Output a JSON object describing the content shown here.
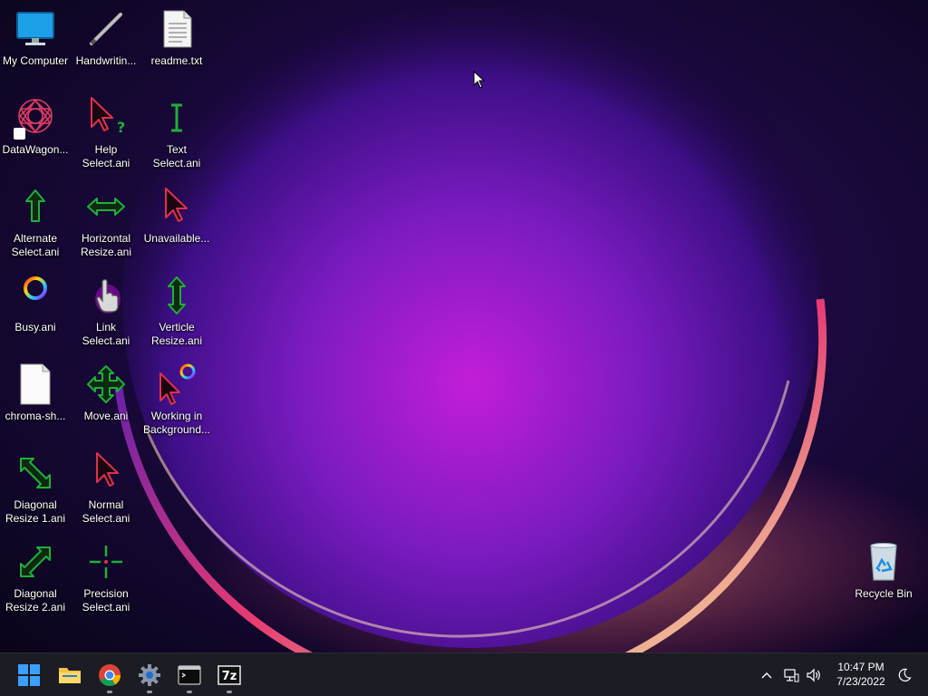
{
  "desktop": {
    "icons": [
      {
        "label": "My Computer",
        "icon": "monitor-icon"
      },
      {
        "label": "Handwritin...",
        "icon": "pen-icon"
      },
      {
        "label": "readme.txt",
        "icon": "text-file-icon"
      },
      {
        "label": "DataWagon...",
        "icon": "mandala-shortcut-icon"
      },
      {
        "label": "Help\nSelect.ani",
        "icon": "help-cursor-icon"
      },
      {
        "label": "Text Select.ani",
        "icon": "text-cursor-icon"
      },
      {
        "label": "Alternate\nSelect.ani",
        "icon": "up-arrow-cursor-icon"
      },
      {
        "label": "Horizontal\nResize.ani",
        "icon": "horizontal-resize-icon"
      },
      {
        "label": "Unavailable...",
        "icon": "unavailable-cursor-icon"
      },
      {
        "label": "Busy.ani",
        "icon": "busy-ring-icon"
      },
      {
        "label": "Link\nSelect.ani",
        "icon": "hand-cursor-icon"
      },
      {
        "label": "Verticle\nResize.ani",
        "icon": "vertical-resize-icon"
      },
      {
        "label": "chroma-sh...",
        "icon": "blank-file-icon"
      },
      {
        "label": "Move.ani",
        "icon": "move-cursor-icon"
      },
      {
        "label": "Working in\nBackground...",
        "icon": "working-cursor-icon"
      },
      {
        "label": "Diagonal\nResize 1.ani",
        "icon": "diagonal-resize-1-icon"
      },
      {
        "label": "Normal\nSelect.ani",
        "icon": "normal-cursor-icon"
      },
      {
        "label": "Diagonal\nResize 2.ani",
        "icon": "diagonal-resize-2-icon"
      },
      {
        "label": "Precision\nSelect.ani",
        "icon": "precision-cursor-icon"
      },
      {
        "label": "Recycle Bin",
        "icon": "recycle-bin-icon"
      }
    ]
  },
  "taskbar": {
    "apps": [
      {
        "name": "start",
        "icon": "windows-logo-icon",
        "running": false
      },
      {
        "name": "file-explorer",
        "icon": "folder-icon",
        "running": false
      },
      {
        "name": "chrome",
        "icon": "chrome-icon",
        "running": true
      },
      {
        "name": "settings",
        "icon": "gear-icon",
        "running": true
      },
      {
        "name": "terminal",
        "icon": "terminal-icon",
        "running": true
      },
      {
        "name": "7-zip",
        "icon": "7zip-icon",
        "running": true
      }
    ],
    "zip_label": "7z",
    "tray": {
      "chevron": "chevron-up-icon",
      "network": "network-icon",
      "volume": "speaker-icon",
      "time": "10:47 PM",
      "date": "7/23/2022",
      "focus": "moon-icon"
    }
  },
  "colors": {
    "cursor_green": "#1fae3a",
    "cursor_red": "#e0304a",
    "taskbar_bg": "#1c1c24",
    "wallpaper_base": "#100722",
    "wallpaper_glow": "#b11fd4",
    "wallpaper_rim": "#ff5a8a"
  }
}
